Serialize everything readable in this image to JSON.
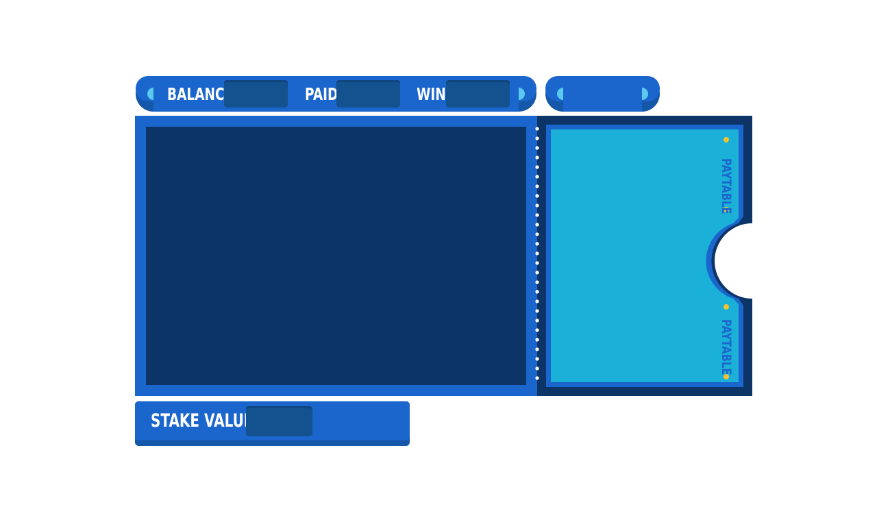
{
  "colors": {
    "primary_blue": "#1b66cc",
    "shadow_blue": "#1557a8",
    "dark_navy": "#0d3466",
    "value_box": "#13528f",
    "light_cyan": "#1bb0d8",
    "accent_cyan": "#5bc8ee",
    "gold_dot": "#f2c32e",
    "text_white": "#ffffff",
    "paytable_text": "#1b66cc"
  },
  "top_bar": {
    "balance_label": "BALANCE",
    "balance_value": "",
    "paid_label": "PAID",
    "paid_value": "",
    "win_label": "WIN",
    "win_value": ""
  },
  "side_pill": {
    "value": ""
  },
  "paytable": {
    "top_label": "PAYTABLE",
    "bottom_label": "PAYTABLE"
  },
  "stake": {
    "label": "STAKE VALUE",
    "value": ""
  }
}
